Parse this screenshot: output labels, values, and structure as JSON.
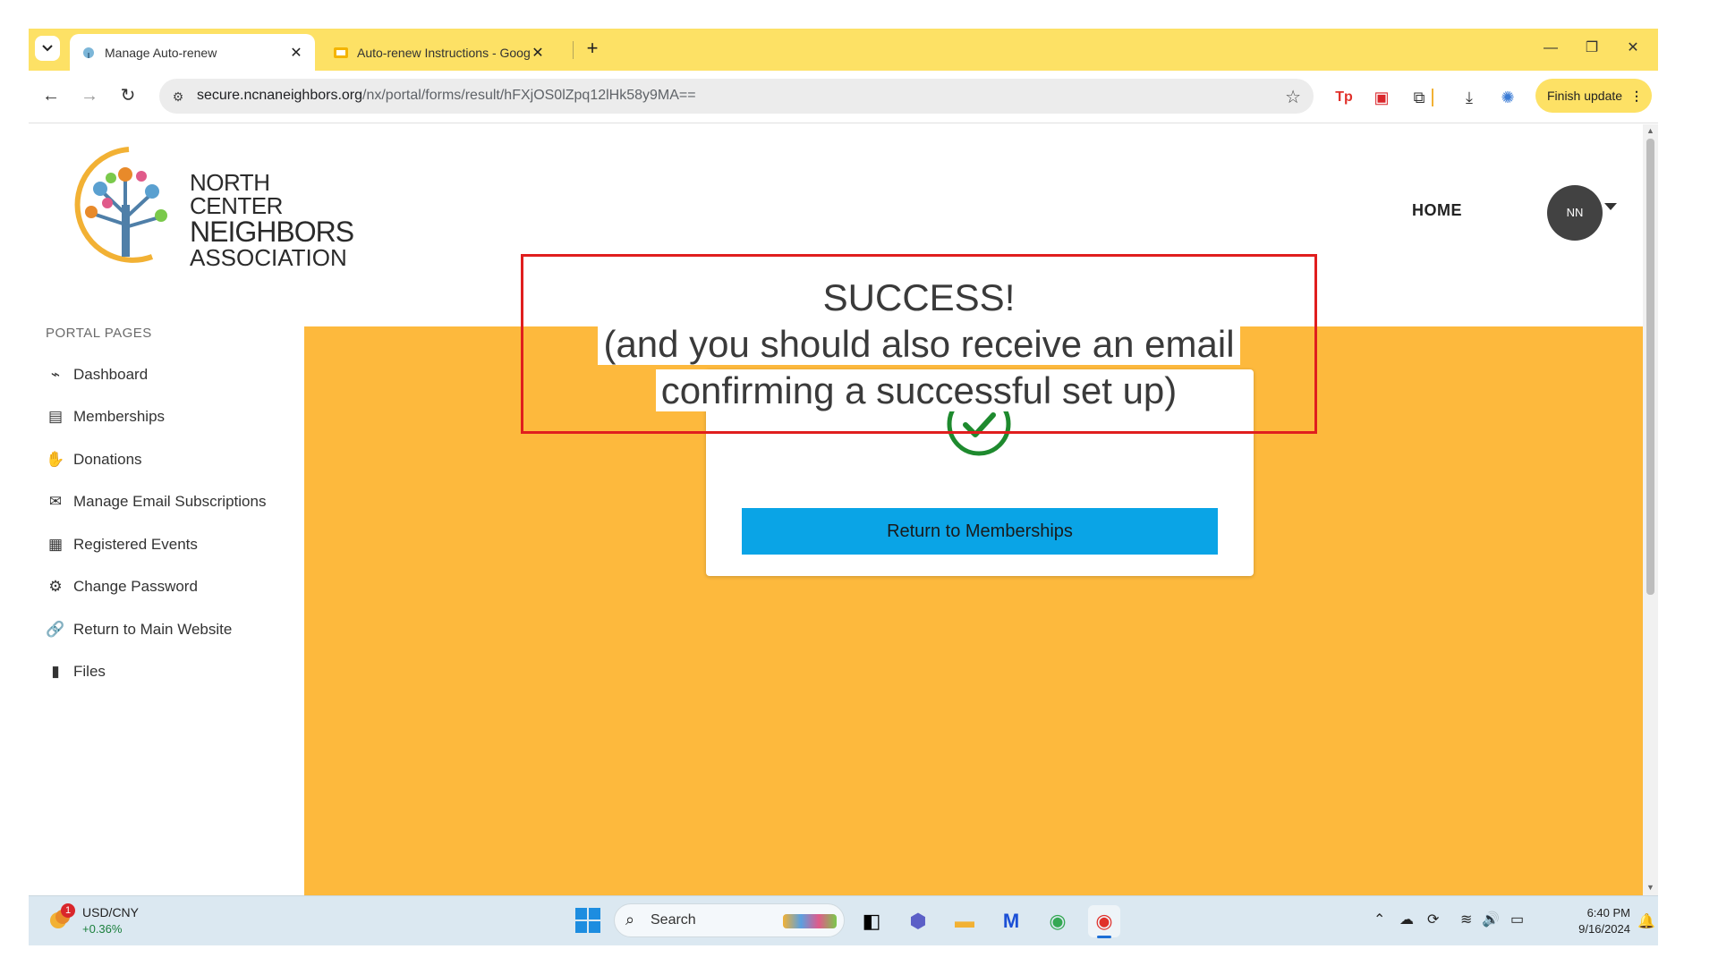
{
  "browser": {
    "tabs": [
      {
        "title": "Manage Auto-renew",
        "active": true
      },
      {
        "title": "Auto-renew Instructions - Goog",
        "active": false
      }
    ],
    "new_tab_label": "+",
    "close_glyph": "✕",
    "url_host": "secure.ncnaneighbors.org",
    "url_path": "/nx/portal/forms/result/hFXjOS0lZpq12lHk58y9MA==",
    "finish_update_label": "Finish update",
    "window_controls": {
      "minimize": "—",
      "restore": "❐",
      "close": "✕"
    }
  },
  "site": {
    "logo_lines": [
      "NORTH CENTER",
      "NEIGHBORS",
      "ASSOCIATION"
    ],
    "nav_home": "HOME",
    "avatar_initials": "NN"
  },
  "sidebar": {
    "heading": "PORTAL PAGES",
    "items": [
      {
        "label": "Dashboard",
        "icon": "pulse-icon",
        "glyph": "⌁"
      },
      {
        "label": "Memberships",
        "icon": "id-card-icon",
        "glyph": "▤"
      },
      {
        "label": "Donations",
        "icon": "donate-hand-icon",
        "glyph": "✋"
      },
      {
        "label": "Manage Email Subscriptions",
        "icon": "envelope-icon",
        "glyph": "✉"
      },
      {
        "label": "Registered Events",
        "icon": "calendar-check-icon",
        "glyph": "▦"
      },
      {
        "label": "Change Password",
        "icon": "user-gear-icon",
        "glyph": "⚙"
      },
      {
        "label": "Return to Main Website",
        "icon": "link-icon",
        "glyph": "🔗"
      },
      {
        "label": "Files",
        "icon": "file-icon",
        "glyph": "▮"
      }
    ]
  },
  "result": {
    "button_label": "Return to Memberships"
  },
  "annotation": {
    "line1": "SUCCESS!",
    "line2": "(and you should also receive an email",
    "line3": "confirming a successful set up)"
  },
  "taskbar": {
    "widget_title": "USD/CNY",
    "widget_change": "+0.36%",
    "widget_badge": "1",
    "search_placeholder": "Search",
    "time": "6:40 PM",
    "date": "9/16/2024"
  },
  "colors": {
    "tab_strip": "#fde165",
    "content_bg": "#fdb93d",
    "button_bg": "#0aa4e6",
    "annotation_border": "#e01e1e",
    "success_green": "#1e8a2e"
  }
}
